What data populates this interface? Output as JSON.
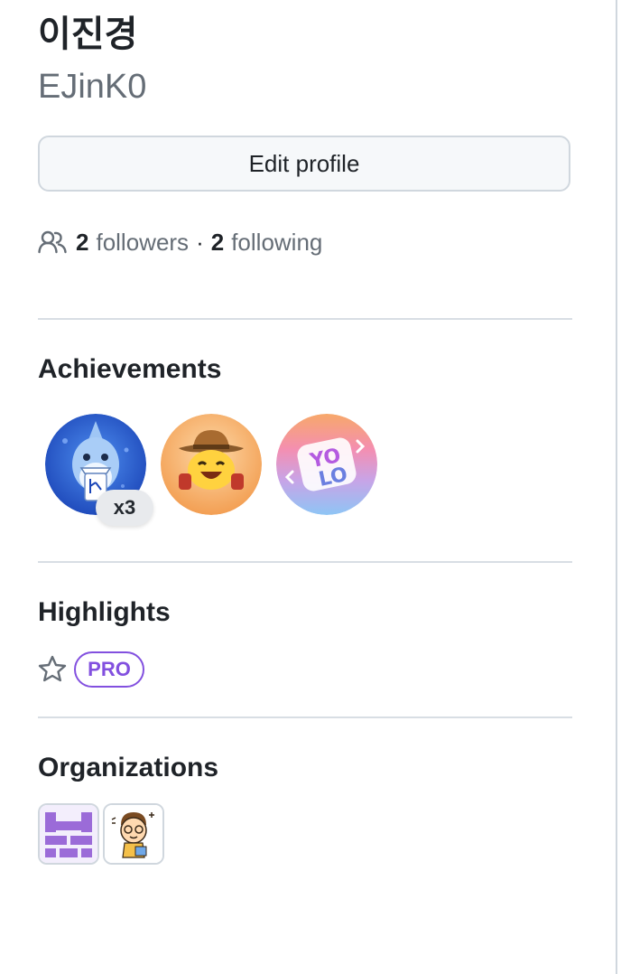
{
  "profile": {
    "display_name": "이진경",
    "username": "EJinK0"
  },
  "actions": {
    "edit_profile_label": "Edit profile"
  },
  "follow": {
    "followers_count": "2",
    "followers_label": "followers",
    "separator": "·",
    "following_count": "2",
    "following_label": "following"
  },
  "achievements": {
    "title": "Achievements",
    "badges": [
      {
        "icon": "shark-badge-icon",
        "count": "x3"
      },
      {
        "icon": "cowboy-badge-icon"
      },
      {
        "icon": "yolo-badge-icon"
      }
    ]
  },
  "highlights": {
    "title": "Highlights",
    "pro_label": "PRO"
  },
  "organizations": {
    "title": "Organizations",
    "items": [
      {
        "icon": "purple-pixel-org-icon"
      },
      {
        "icon": "cartoon-character-org-icon"
      }
    ]
  },
  "colors": {
    "text": "#1f2328",
    "muted": "#656d76",
    "border": "#d0d7de",
    "pro_purple": "#8250df"
  }
}
